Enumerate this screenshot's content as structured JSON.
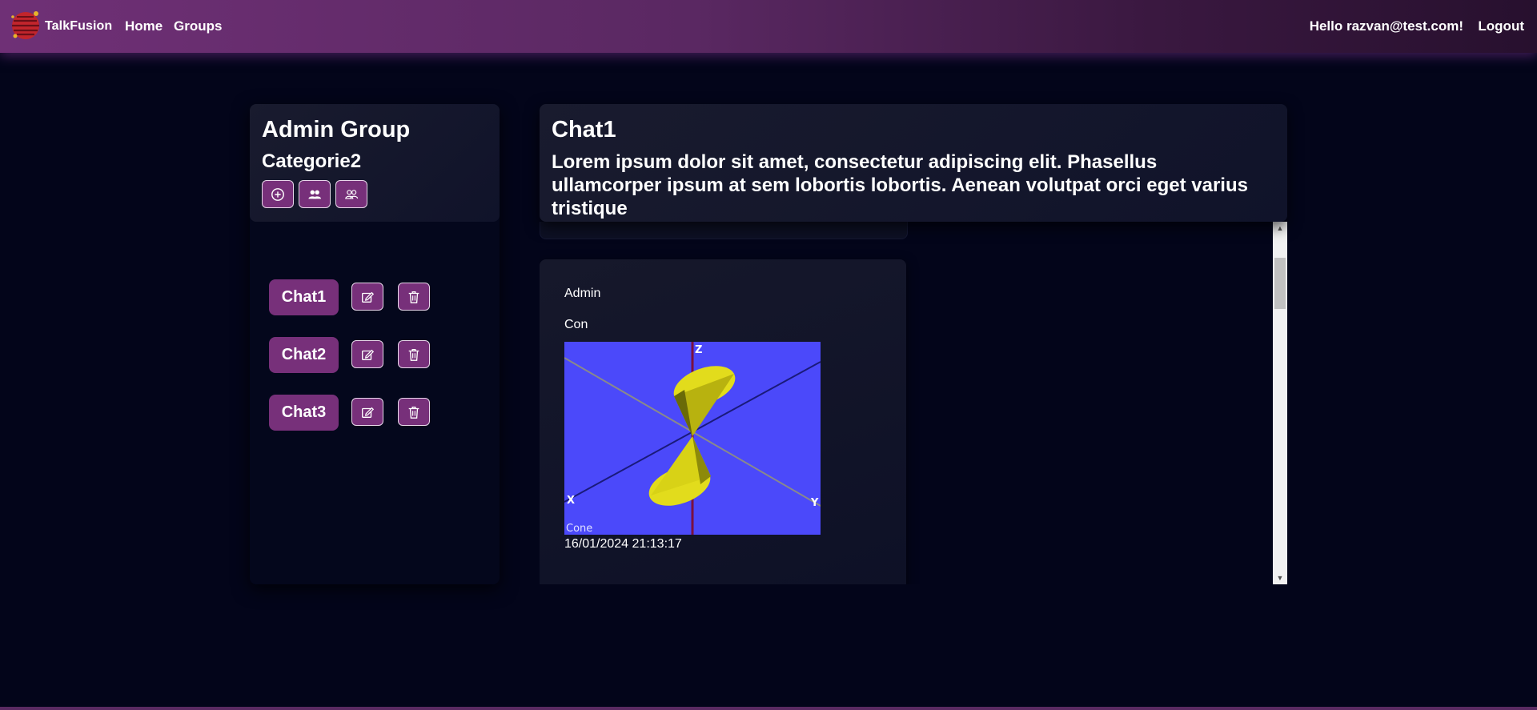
{
  "navbar": {
    "brand": "TalkFusion",
    "links": [
      "Home",
      "Groups"
    ],
    "greeting": "Hello razvan@test.com!",
    "logout": "Logout",
    "logo_icon": "planet-logo"
  },
  "sidebar": {
    "group_name": "Admin Group",
    "category": "Categorie2",
    "action_icons": [
      "plus-circle-icon",
      "users-icon",
      "users-outline-icon"
    ],
    "chats": [
      {
        "name": "Chat1",
        "edit_icon": "edit-icon",
        "delete_icon": "trash-icon"
      },
      {
        "name": "Chat2",
        "edit_icon": "edit-icon",
        "delete_icon": "trash-icon"
      },
      {
        "name": "Chat3",
        "edit_icon": "edit-icon",
        "delete_icon": "trash-icon"
      }
    ]
  },
  "chat": {
    "title": "Chat1",
    "description": "Lorem ipsum dolor sit amet, consectetur adipiscing elit. Phasellus ullamcorper ipsum at sem lobortis lobortis. Aenean volutpat orci eget varius tristique"
  },
  "message": {
    "author": "Admin",
    "text": "Con",
    "image": {
      "axis_labels": [
        "Z",
        "X",
        "Y"
      ],
      "caption": "Cone"
    },
    "timestamp": "16/01/2024 21:13:17"
  },
  "colors": {
    "background": "#03051a",
    "accent": "#77307a",
    "navbar_start": "#6f3076",
    "navbar_end": "#27102e",
    "image_background": "#4b49fa",
    "cone": "#e2dc1c"
  }
}
